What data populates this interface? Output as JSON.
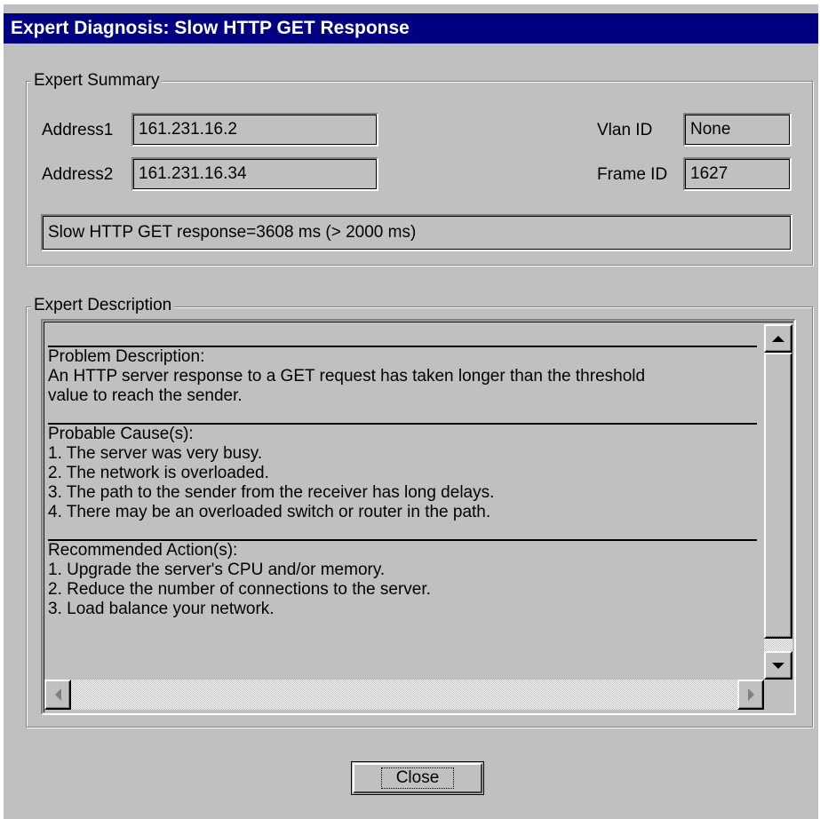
{
  "window": {
    "title": "Expert Diagnosis: Slow HTTP GET Response"
  },
  "summary": {
    "legend": "Expert Summary",
    "address1_label": "Address1",
    "address1_value": "161.231.16.2",
    "address2_label": "Address2",
    "address2_value": "161.231.16.34",
    "vlan_label": "Vlan ID",
    "vlan_value": "None",
    "frame_label": "Frame ID",
    "frame_value": "1627",
    "message": "Slow HTTP GET response=3608 ms (> 2000 ms)"
  },
  "description": {
    "legend": "Expert Description",
    "problem": {
      "heading": "Problem Description:",
      "lines": [
        "An HTTP server response to a GET request has taken longer than the threshold",
        "value to reach the sender."
      ]
    },
    "causes": {
      "heading": "Probable Cause(s):",
      "lines": [
        "1. The server was very busy.",
        "2. The network is overloaded.",
        "3. The path to the sender from the receiver has long delays.",
        "4. There may be an overloaded switch or router in the path."
      ]
    },
    "actions": {
      "heading": "Recommended Action(s):",
      "lines": [
        "1. Upgrade the server's CPU and/or memory.",
        "2. Reduce the number of connections to the server.",
        "3. Load balance your network."
      ]
    }
  },
  "buttons": {
    "close_label": "Close"
  },
  "icons": {
    "scroll_up": "arrow-up-icon",
    "scroll_down": "arrow-down-icon",
    "scroll_left": "arrow-left-icon",
    "scroll_right": "arrow-right-icon"
  },
  "colors": {
    "titlebar": "#000080",
    "face": "#c0c0c0"
  }
}
